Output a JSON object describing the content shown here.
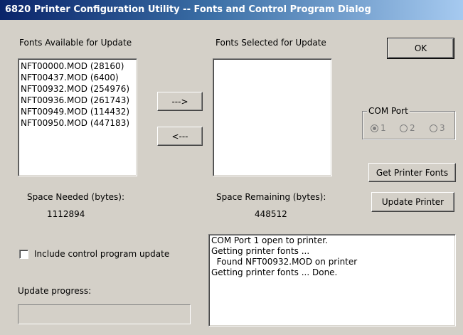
{
  "window": {
    "title": "6820 Printer Configuration Utility -- Fonts and Control Program Dialog"
  },
  "available": {
    "label": "Fonts Available for Update",
    "items": [
      "NFT00000.MOD (28160)",
      "NFT00437.MOD (6400)",
      "NFT00932.MOD (254976)",
      "NFT00936.MOD (261743)",
      "NFT00949.MOD (114432)",
      "NFT00950.MOD (447183)"
    ],
    "space_label": "Space Needed (bytes):",
    "space_value": "1112894"
  },
  "selected": {
    "label": "Fonts Selected for Update",
    "items": [],
    "space_label": "Space Remaining (bytes):",
    "space_value": "448512"
  },
  "buttons": {
    "add": "--->",
    "remove": "<---",
    "ok": "OK",
    "get_fonts": "Get Printer Fonts",
    "update": "Update Printer"
  },
  "com_port": {
    "label": "COM Port",
    "options": [
      "1",
      "2",
      "3"
    ],
    "selected": "1",
    "enabled": false
  },
  "control_program": {
    "label": "Include control program update",
    "checked": false
  },
  "progress": {
    "label": "Update progress:",
    "value": 0
  },
  "log": {
    "lines": [
      "COM Port 1 open to printer.",
      "Getting printer fonts ...",
      "  Found NFT00932.MOD on printer",
      "Getting printer fonts ... Done."
    ]
  }
}
